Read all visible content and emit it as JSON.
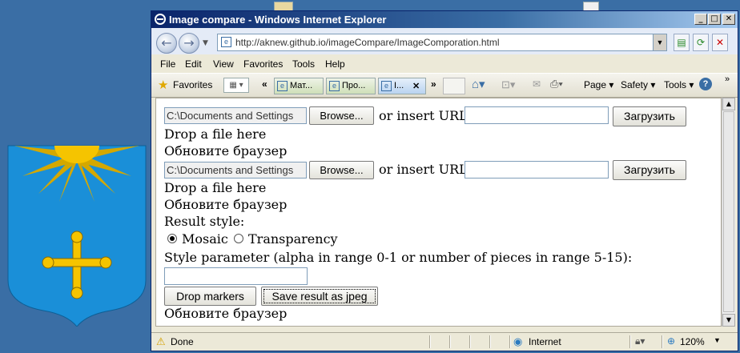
{
  "window": {
    "title": "Image compare - Windows Internet Explorer",
    "min_glyph": "_",
    "max_glyph": "□",
    "close_glyph": "✕"
  },
  "address": {
    "url": "http://aknew.github.io/imageCompare/ImageComporation.html",
    "dropdown_glyph": "▼"
  },
  "nav": {
    "back_glyph": "←",
    "forward_glyph": "→"
  },
  "menu": [
    "File",
    "Edit",
    "View",
    "Favorites",
    "Tools",
    "Help"
  ],
  "favorites": {
    "label": "Favorites",
    "tab_overflow_left": "«",
    "tab_overflow_right": "»",
    "tabs": [
      {
        "label": "Мат..."
      },
      {
        "label": "Про..."
      },
      {
        "label": "I..."
      }
    ],
    "tab_close_glyph": "✕",
    "page_menu": "Page",
    "safety_menu": "Safety",
    "tools_menu": "Tools",
    "help_glyph": "?"
  },
  "page": {
    "file1": {
      "path": "C:\\Documents and Settings",
      "browse_label": "Browse...",
      "or_insert": "or insert URL",
      "url_value": "",
      "load_label": "Загрузить",
      "drop_text": "Drop a file here",
      "update_text": "Обновите браузер"
    },
    "file2": {
      "path": "C:\\Documents and Settings",
      "browse_label": "Browse...",
      "or_insert": "or insert URL",
      "url_value": "",
      "load_label": "Загрузить",
      "drop_text": "Drop a file here",
      "update_text": "Обновите браузер"
    },
    "result_style_label": "Result style:",
    "radio_options": [
      {
        "label": "Mosaic",
        "checked": true
      },
      {
        "label": "Transparency",
        "checked": false
      }
    ],
    "style_param_label": "Style parameter (alpha in range 0-1 or number of pieces in range 5-15):",
    "style_param_value": "",
    "drop_markers_label": "Drop markers",
    "save_jpeg_label": "Save result as jpeg",
    "bottom_update_text": "Обновите браузер"
  },
  "status": {
    "text": "Done",
    "zone": "Internet",
    "zoom": "120%"
  },
  "colors": {
    "desktop": "#3a6ea5",
    "titlebar_start": "#0a246a",
    "crest_blue": "#1a8fd8",
    "crest_gold": "#f5c400"
  }
}
